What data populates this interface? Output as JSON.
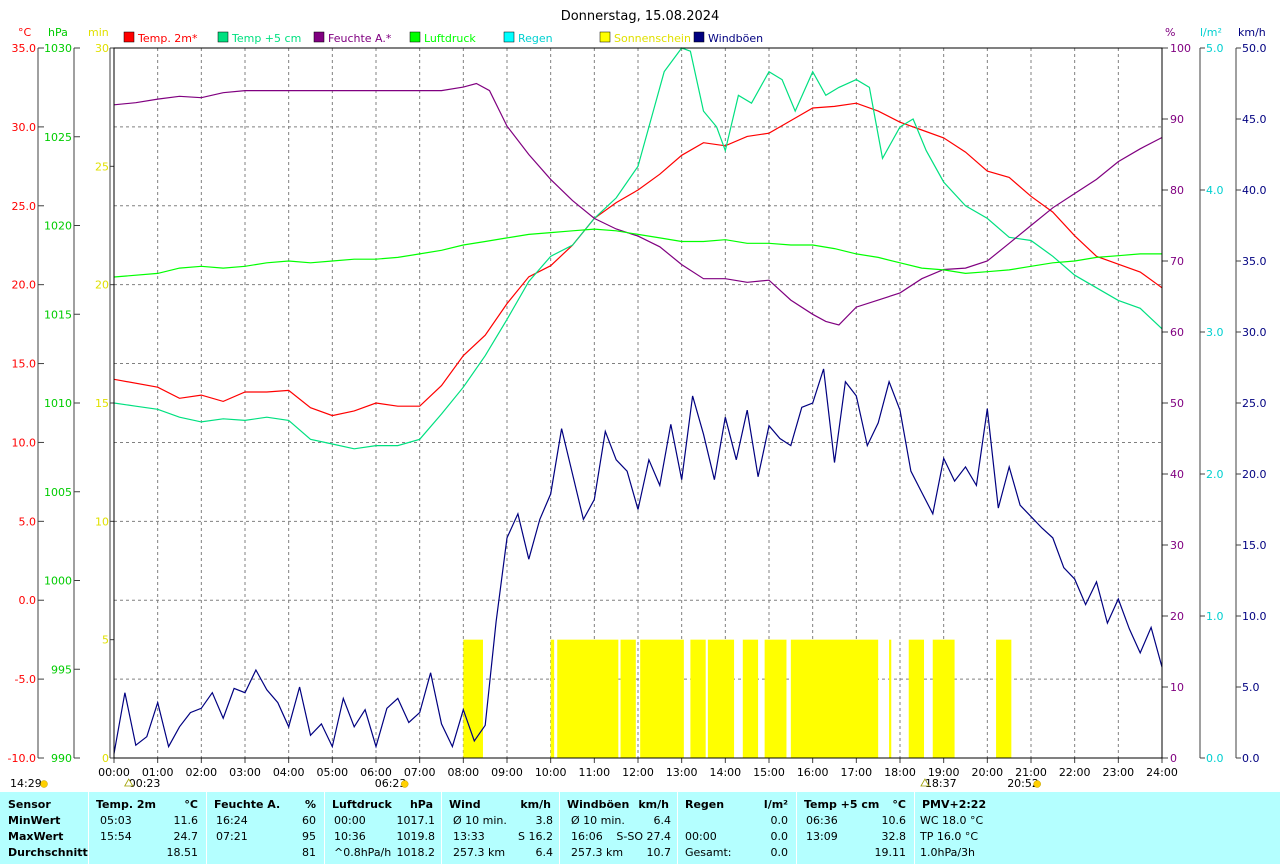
{
  "title": "Donnerstag, 15.08.2024",
  "axes": {
    "temp": {
      "unit": "°C",
      "ticks": [
        "35.0",
        "30.0",
        "25.0",
        "20.0",
        "15.0",
        "10.0",
        "5.0",
        "0.0",
        "-5.0",
        "-10.0"
      ],
      "color": "#ff0000"
    },
    "pressure": {
      "unit": "hPa",
      "ticks": [
        "1030",
        "1025",
        "1020",
        "1015",
        "1010",
        "1005",
        "1000",
        "995",
        "990"
      ],
      "color": "#00cc00"
    },
    "sunshine": {
      "unit": "min",
      "ticks": [
        "30",
        "25",
        "20",
        "15",
        "10",
        "5",
        "0"
      ],
      "color": "#ffff00"
    },
    "humidity": {
      "unit": "%",
      "ticks": [
        "100",
        "90",
        "80",
        "70",
        "60",
        "50",
        "40",
        "30",
        "20",
        "10",
        "0"
      ],
      "color": "#800080"
    },
    "rain": {
      "unit": "l/m²",
      "ticks": [
        "5.0",
        "4.0",
        "3.0",
        "2.0",
        "1.0",
        "0.0"
      ],
      "color": "#00ffff"
    },
    "wind": {
      "unit": "km/h",
      "ticks": [
        "50.0",
        "45.0",
        "40.0",
        "35.0",
        "30.0",
        "25.0",
        "20.0",
        "15.0",
        "10.0",
        "5.0",
        "0.0"
      ],
      "color": "#000080"
    },
    "x_ticks": [
      "00:00",
      "01:00",
      "02:00",
      "03:00",
      "04:00",
      "05:00",
      "06:00",
      "07:00",
      "08:00",
      "09:00",
      "10:00",
      "11:00",
      "12:00",
      "13:00",
      "14:00",
      "15:00",
      "16:00",
      "17:00",
      "18:00",
      "19:00",
      "20:00",
      "21:00",
      "22:00",
      "23:00",
      "24:00"
    ]
  },
  "legend": [
    {
      "label": "Temp. 2m*",
      "color": "#ff0000"
    },
    {
      "label": "Temp +5 cm",
      "color": "#00e080"
    },
    {
      "label": "Feuchte A.*",
      "color": "#800080"
    },
    {
      "label": "Luftdruck",
      "color": "#00ff00"
    },
    {
      "label": "Regen",
      "color": "#00ffff"
    },
    {
      "label": "Sonnenschein",
      "color": "#ffff00"
    },
    {
      "label": "Windböen",
      "color": "#000080"
    }
  ],
  "markers": [
    {
      "label": "00:23",
      "hour": 0.383,
      "icon": "moon-icon",
      "row": "upper"
    },
    {
      "label": "14:29",
      "hour": -99,
      "icon": "sun-icon",
      "row": "left"
    },
    {
      "label": "06:23",
      "hour": 6.383,
      "icon": "sun-icon",
      "row": "lower"
    },
    {
      "label": "18:37",
      "hour": 18.617,
      "icon": "moon-icon",
      "row": "upper"
    },
    {
      "label": "20:52",
      "hour": 20.867,
      "icon": "sun-icon",
      "row": "lower"
    }
  ],
  "chart_data": {
    "type": "line",
    "title": "Donnerstag, 15.08.2024",
    "x_unit": "hour of day",
    "xlim": [
      0,
      24
    ],
    "grid": true,
    "legend_placement": "top",
    "series": [
      {
        "name": "Temp. 2m*",
        "axis": "temp",
        "ylim": [
          -10,
          35
        ],
        "color": "#ff0000",
        "x": [
          0,
          1,
          1.5,
          2,
          2.5,
          3,
          3.5,
          4,
          4.5,
          5,
          5.5,
          6,
          6.5,
          7,
          7.5,
          8,
          8.5,
          9,
          9.5,
          10,
          10.5,
          11,
          11.5,
          12,
          12.5,
          13,
          13.5,
          14,
          14.5,
          15,
          15.5,
          16,
          16.5,
          17,
          17.5,
          18,
          18.5,
          19,
          19.5,
          20,
          20.5,
          21,
          21.5,
          22,
          22.5,
          23,
          23.5,
          24
        ],
        "y": [
          14.0,
          13.5,
          12.8,
          13.0,
          12.6,
          13.2,
          13.2,
          13.3,
          12.2,
          11.7,
          12.0,
          12.5,
          12.3,
          12.3,
          13.6,
          15.5,
          16.8,
          18.8,
          20.5,
          21.2,
          22.5,
          24.2,
          25.2,
          26.0,
          27.0,
          28.2,
          29.0,
          28.8,
          29.4,
          29.6,
          30.4,
          31.2,
          31.3,
          31.5,
          31.0,
          30.3,
          29.8,
          29.3,
          28.4,
          27.2,
          26.8,
          25.6,
          24.6,
          23.1,
          21.8,
          21.3,
          20.8,
          19.8
        ]
      },
      {
        "name": "Temp +5 cm",
        "axis": "temp",
        "ylim": [
          -10,
          35
        ],
        "color": "#00e080",
        "x": [
          0,
          0.5,
          1,
          1.5,
          2,
          2.5,
          3,
          3.5,
          4,
          4.5,
          5,
          5.5,
          6,
          6.5,
          7,
          7.5,
          8,
          8.5,
          9,
          9.5,
          10,
          10.5,
          11,
          11.5,
          12,
          12.3,
          12.6,
          13,
          13.2,
          13.5,
          13.8,
          14,
          14.3,
          14.6,
          15,
          15.3,
          15.6,
          16,
          16.3,
          16.6,
          17,
          17.3,
          17.6,
          18,
          18.3,
          18.6,
          19,
          19.5,
          20,
          20.5,
          21,
          21.5,
          22,
          22.5,
          23,
          23.5,
          24
        ],
        "y": [
          12.5,
          12.3,
          12.1,
          11.6,
          11.3,
          11.5,
          11.4,
          11.6,
          11.4,
          10.2,
          9.9,
          9.6,
          9.8,
          9.8,
          10.2,
          11.8,
          13.5,
          15.5,
          17.8,
          20.2,
          21.8,
          22.5,
          24.2,
          25.5,
          27.5,
          30.5,
          33.5,
          35.0,
          34.8,
          31.0,
          30.0,
          28.5,
          32.0,
          31.5,
          33.5,
          33.0,
          31.0,
          33.5,
          32.0,
          32.5,
          33.0,
          32.5,
          28.0,
          30.0,
          30.5,
          28.5,
          26.5,
          25.0,
          24.2,
          23.0,
          22.8,
          21.8,
          20.6,
          19.8,
          19.0,
          18.5,
          17.2
        ]
      },
      {
        "name": "Feuchte A.*",
        "axis": "humidity",
        "ylim": [
          0,
          100
        ],
        "color": "#800080",
        "x": [
          0,
          0.5,
          1,
          1.5,
          2,
          2.5,
          3,
          3.5,
          4,
          4.5,
          5,
          5.5,
          6,
          6.5,
          7,
          7.5,
          8,
          8.3,
          8.6,
          9,
          9.5,
          10,
          10.5,
          11,
          11.5,
          12,
          12.5,
          13,
          13.5,
          14,
          14.5,
          15,
          15.5,
          16,
          16.3,
          16.6,
          17,
          17.5,
          18,
          18.5,
          19,
          19.5,
          20,
          20.5,
          21,
          21.5,
          22,
          22.5,
          23,
          23.5,
          24
        ],
        "y": [
          92.0,
          92.3,
          92.8,
          93.2,
          93.0,
          93.7,
          94.0,
          94.0,
          94.0,
          94.0,
          94.0,
          94.0,
          94.0,
          94.0,
          94.0,
          94.0,
          94.5,
          95.0,
          94.0,
          89.0,
          85.0,
          81.5,
          78.5,
          76.0,
          74.5,
          73.5,
          72.0,
          69.5,
          67.5,
          67.5,
          67.0,
          67.3,
          64.5,
          62.5,
          61.5,
          61.0,
          63.5,
          64.5,
          65.5,
          67.5,
          68.8,
          69.0,
          70.0,
          72.5,
          75.0,
          77.5,
          79.5,
          81.5,
          84.0,
          85.8,
          87.4
        ]
      },
      {
        "name": "Luftdruck",
        "axis": "pressure",
        "ylim": [
          990,
          1030
        ],
        "color": "#00ff00",
        "x": [
          0,
          1,
          1.5,
          2,
          2.5,
          3,
          3.5,
          4,
          4.5,
          5,
          5.5,
          6,
          6.5,
          7,
          7.5,
          8,
          8.5,
          9,
          9.5,
          10,
          10.5,
          11,
          11.5,
          12,
          12.5,
          13,
          13.5,
          14,
          14.5,
          15,
          15.5,
          16,
          16.5,
          17,
          17.5,
          18,
          18.5,
          19,
          19.5,
          20,
          20.5,
          21,
          21.5,
          22,
          22.5,
          23,
          23.5,
          24
        ],
        "y": [
          1017.1,
          1017.3,
          1017.6,
          1017.7,
          1017.6,
          1017.7,
          1017.9,
          1018.0,
          1017.9,
          1018.0,
          1018.1,
          1018.1,
          1018.2,
          1018.4,
          1018.6,
          1018.9,
          1019.1,
          1019.3,
          1019.5,
          1019.6,
          1019.7,
          1019.8,
          1019.7,
          1019.5,
          1019.3,
          1019.1,
          1019.1,
          1019.2,
          1019.0,
          1019.0,
          1018.9,
          1018.9,
          1018.7,
          1018.4,
          1018.2,
          1017.9,
          1017.6,
          1017.5,
          1017.3,
          1017.4,
          1017.5,
          1017.7,
          1017.9,
          1018.0,
          1018.2,
          1018.3,
          1018.4,
          1018.4
        ]
      },
      {
        "name": "Windböen",
        "axis": "wind",
        "ylim": [
          0,
          50
        ],
        "color": "#000080",
        "x": [
          0,
          0.25,
          0.5,
          0.75,
          1,
          1.25,
          1.5,
          1.75,
          2,
          2.25,
          2.5,
          2.75,
          3,
          3.25,
          3.5,
          3.75,
          4,
          4.25,
          4.5,
          4.75,
          5,
          5.25,
          5.5,
          5.75,
          6,
          6.25,
          6.5,
          6.75,
          7,
          7.25,
          7.5,
          7.75,
          8,
          8.25,
          8.5,
          8.75,
          9,
          9.25,
          9.5,
          9.75,
          10,
          10.25,
          10.5,
          10.75,
          11,
          11.25,
          11.5,
          11.75,
          12,
          12.25,
          12.5,
          12.75,
          13,
          13.25,
          13.5,
          13.75,
          14,
          14.25,
          14.5,
          14.75,
          15,
          15.25,
          15.5,
          15.75,
          16,
          16.25,
          16.5,
          16.75,
          17,
          17.25,
          17.5,
          17.75,
          18,
          18.25,
          18.5,
          18.75,
          19,
          19.25,
          19.5,
          19.75,
          20,
          20.25,
          20.5,
          20.75,
          21,
          21.25,
          21.5,
          21.75,
          22,
          22.25,
          22.5,
          22.75,
          23,
          23.25,
          23.5,
          23.75,
          24
        ],
        "y": [
          0.3,
          4.6,
          0.9,
          1.5,
          3.9,
          0.8,
          2.2,
          3.2,
          3.5,
          4.6,
          2.8,
          4.9,
          4.6,
          6.2,
          4.8,
          3.9,
          2.2,
          5.0,
          1.6,
          2.4,
          0.8,
          4.2,
          2.2,
          3.4,
          0.8,
          3.5,
          4.2,
          2.5,
          3.2,
          6.0,
          2.4,
          0.8,
          3.4,
          1.2,
          2.3,
          9.6,
          15.5,
          17.2,
          14.0,
          16.8,
          18.6,
          23.2,
          20.0,
          16.8,
          18.2,
          23.0,
          21.0,
          20.2,
          17.5,
          21.0,
          19.2,
          23.5,
          19.6,
          25.5,
          22.8,
          19.6,
          24.0,
          21.0,
          24.5,
          19.8,
          23.4,
          22.5,
          22.0,
          24.7,
          25.0,
          27.4,
          20.8,
          26.5,
          25.5,
          22.0,
          23.6,
          26.5,
          24.5,
          20.2,
          18.7,
          17.2,
          21.1,
          19.5,
          20.5,
          19.2,
          24.6,
          17.6,
          20.5,
          17.8,
          17.0,
          16.2,
          15.5,
          13.4,
          12.6,
          10.8,
          12.4,
          9.5,
          11.2,
          9.1,
          7.4,
          9.2,
          6.4
        ]
      }
    ],
    "sunshine": {
      "name": "Sonnenschein",
      "axis": "sunshine",
      "ylim": [
        0,
        30
      ],
      "color": "#ffff00",
      "intervals": [
        [
          8.0,
          8.45
        ],
        [
          10.0,
          10.08
        ],
        [
          10.15,
          11.55
        ],
        [
          11.6,
          11.95
        ],
        [
          12.05,
          13.05
        ],
        [
          13.2,
          13.55
        ],
        [
          13.6,
          14.2
        ],
        [
          14.4,
          14.75
        ],
        [
          14.9,
          15.4
        ],
        [
          15.5,
          17.5
        ],
        [
          17.75,
          17.8
        ],
        [
          18.2,
          18.55
        ],
        [
          18.75,
          19.25
        ],
        [
          20.2,
          20.55
        ]
      ],
      "level": 5
    }
  },
  "stats": {
    "headers": [
      {
        "name": "Sensor",
        "unit": ""
      },
      {
        "name": "Temp. 2m",
        "unit": "°C"
      },
      {
        "name": "Feuchte A.",
        "unit": "%"
      },
      {
        "name": "Luftdruck",
        "unit": "hPa"
      },
      {
        "name": "Wind",
        "unit": "km/h"
      },
      {
        "name": "Windböen",
        "unit": "km/h"
      },
      {
        "name": "Regen",
        "unit": "l/m²"
      },
      {
        "name": "Temp +5 cm",
        "unit": "°C"
      },
      {
        "name": "PMV+2:22",
        "unit": ""
      }
    ],
    "row_labels": [
      "MinWert",
      "MaxWert",
      "Durchschnitt"
    ],
    "temp2m": [
      [
        "05:03",
        "11.6"
      ],
      [
        "15:54",
        "24.7"
      ],
      [
        "",
        "18.51"
      ]
    ],
    "feuchte": [
      [
        "16:24",
        "60"
      ],
      [
        "07:21",
        "95"
      ],
      [
        "",
        "81"
      ]
    ],
    "luftdruck": [
      [
        "00:00",
        "1017.1"
      ],
      [
        "10:36",
        "1019.8"
      ],
      [
        "^0.8hPa/h",
        "1018.2"
      ]
    ],
    "wind": [
      [
        "Ø 10 min.",
        "",
        "3.8"
      ],
      [
        "13:33",
        "S",
        "16.2"
      ],
      [
        "257.3 km",
        "",
        "6.4"
      ]
    ],
    "windboeen": [
      [
        "Ø 10 min.",
        "",
        "6.4"
      ],
      [
        "16:06",
        "S-SO",
        "27.4"
      ],
      [
        "257.3 km",
        "",
        "10.7"
      ]
    ],
    "regen": [
      [
        "",
        "0.0"
      ],
      [
        "00:00",
        "0.0"
      ],
      [
        "Gesamt:",
        "0.0"
      ]
    ],
    "temp5cm": [
      [
        "06:36",
        "10.6"
      ],
      [
        "13:09",
        "32.8"
      ],
      [
        "",
        "19.11"
      ]
    ],
    "pmv": [
      "WC 18.0 °C",
      "TP 16.0 °C",
      "1.0hPa/3h"
    ]
  }
}
